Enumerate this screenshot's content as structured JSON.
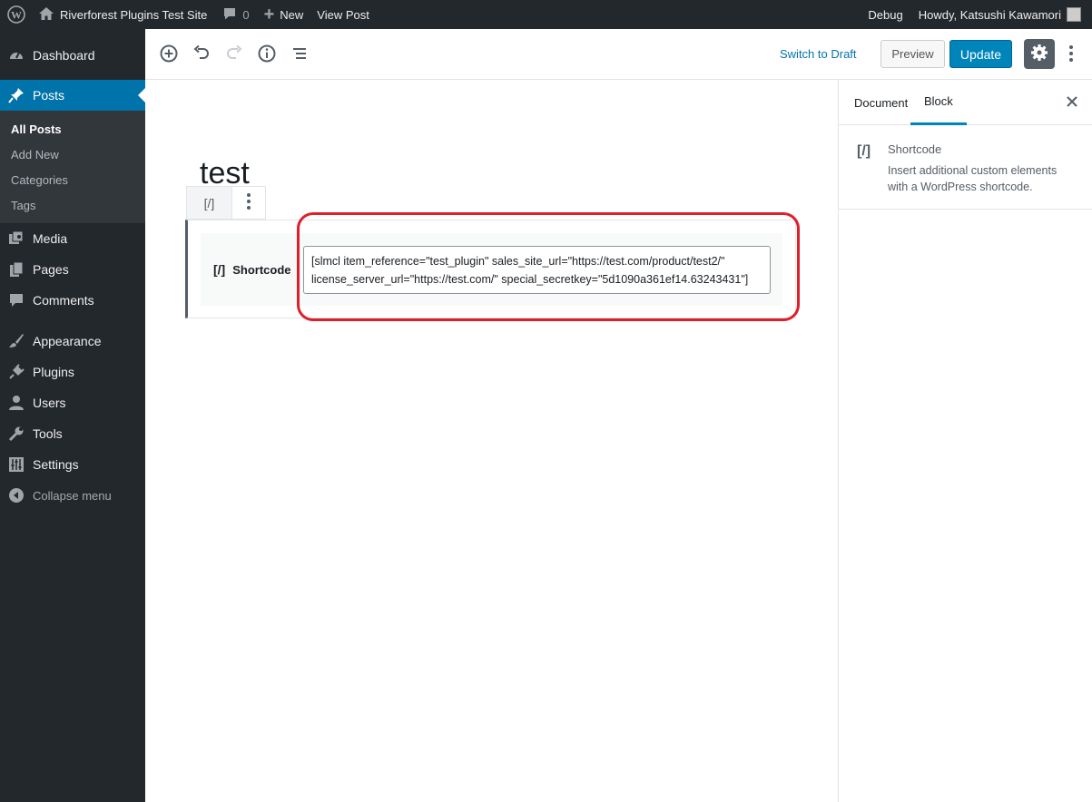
{
  "admin_bar": {
    "site_name": "Riverforest Plugins Test Site",
    "comments_count": "0",
    "new_label": "New",
    "view_post_label": "View Post",
    "debug_label": "Debug",
    "howdy_label": "Howdy, Katsushi Kawamori"
  },
  "sidebar": {
    "items": [
      {
        "label": "Dashboard",
        "icon": "dashboard-icon"
      },
      {
        "label": "Posts",
        "icon": "pin-icon"
      },
      {
        "label": "Media",
        "icon": "media-icon"
      },
      {
        "label": "Pages",
        "icon": "pages-icon"
      },
      {
        "label": "Comments",
        "icon": "comment-icon"
      },
      {
        "label": "Appearance",
        "icon": "brush-icon"
      },
      {
        "label": "Plugins",
        "icon": "plug-icon"
      },
      {
        "label": "Users",
        "icon": "user-icon"
      },
      {
        "label": "Tools",
        "icon": "wrench-icon"
      },
      {
        "label": "Settings",
        "icon": "sliders-icon"
      }
    ],
    "posts_submenu": [
      "All Posts",
      "Add New",
      "Categories",
      "Tags"
    ],
    "collapse_label": "Collapse menu"
  },
  "header": {
    "switch_to_draft": "Switch to Draft",
    "preview": "Preview",
    "update": "Update"
  },
  "editor": {
    "post_title": "test",
    "block_toolbar_glyph": "[/]",
    "shortcode_label": "Shortcode",
    "shortcode_glyph": "[/]",
    "shortcode_value": "[slmcl item_reference=\"test_plugin\" sales_site_url=\"https://test.com/product/test2/\" license_server_url=\"https://test.com/\" special_secretkey=\"5d1090a361ef14.63243431\"]"
  },
  "settings_panel": {
    "tab_document": "Document",
    "tab_block": "Block",
    "block_glyph": "[/]",
    "block_title": "Shortcode",
    "block_description": "Insert additional custom elements with a WordPress shortcode."
  },
  "colors": {
    "admin_bg": "#23282d",
    "accent": "#0073aa",
    "update_btn": "#0085ba",
    "highlight": "#dd1f2a"
  }
}
